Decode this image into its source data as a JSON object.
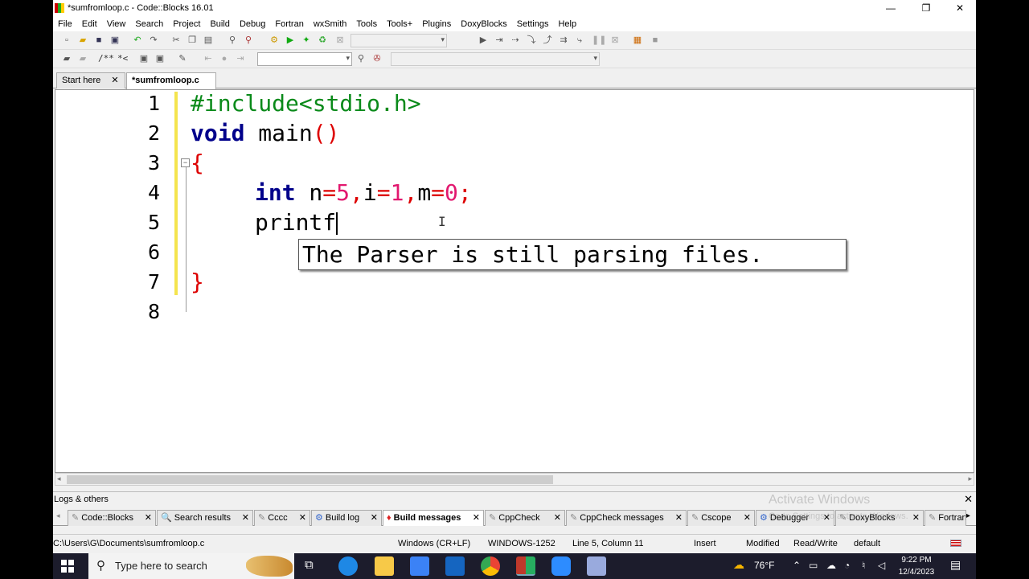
{
  "window": {
    "title": "*sumfromloop.c - Code::Blocks 16.01",
    "controls": {
      "minimize": "—",
      "maximize": "❐",
      "close": "✕"
    }
  },
  "menu": [
    "File",
    "Edit",
    "View",
    "Search",
    "Project",
    "Build",
    "Debug",
    "Fortran",
    "wxSmith",
    "Tools",
    "Tools+",
    "Plugins",
    "DoxyBlocks",
    "Settings",
    "Help"
  ],
  "toolbar2": {
    "comment_label": "/**",
    "stream_label": "*<"
  },
  "editor_tabs": [
    {
      "label": "Start here",
      "close": "✕",
      "active": false
    },
    {
      "label": "*sumfromloop.c",
      "close": "✕",
      "active": true
    }
  ],
  "editor": {
    "line_numbers": [
      "1",
      "2",
      "3",
      "4",
      "5",
      "6",
      "7",
      "8"
    ],
    "fold_marker": "−",
    "line1": {
      "pp": "#include<stdio.h>"
    },
    "line2": {
      "kw": "void",
      "rest": " main",
      "paren": "()"
    },
    "line3": {
      "brace": "{"
    },
    "line4": {
      "kw": "int",
      "a": " n",
      "eq1": "=",
      "n1": "5",
      "c1": ",",
      "b": "i",
      "eq2": "=",
      "n2": "1",
      "c2": ",",
      "c": "m",
      "eq3": "=",
      "n3": "0",
      "semi": ";"
    },
    "line5": {
      "text": "printf"
    },
    "line7": {
      "brace": "}"
    },
    "tooltip": "The Parser is still parsing files."
  },
  "logs": {
    "header": "Logs & others",
    "close": "✕",
    "tabs": [
      {
        "label": "Code::Blocks",
        "icon": "✎",
        "active": false
      },
      {
        "label": "Search results",
        "icon": "🔍",
        "active": false
      },
      {
        "label": "Cccc",
        "icon": "✎",
        "active": false
      },
      {
        "label": "Build log",
        "icon": "⚙",
        "active": false
      },
      {
        "label": "Build messages",
        "icon": "♦",
        "active": true
      },
      {
        "label": "CppCheck",
        "icon": "✎",
        "active": false
      },
      {
        "label": "CppCheck messages",
        "icon": "✎",
        "active": false
      },
      {
        "label": "Cscope",
        "icon": "✎",
        "active": false
      },
      {
        "label": "Debugger",
        "icon": "⚙",
        "active": false
      },
      {
        "label": "DoxyBlocks",
        "icon": "✎",
        "active": false
      },
      {
        "label": "Fortran",
        "icon": "✎",
        "active": false
      }
    ],
    "tab_close": "✕",
    "scroll_right": "▸"
  },
  "status": {
    "path": "C:\\Users\\G\\Documents\\sumfromloop.c",
    "line_endings": "Windows (CR+LF)",
    "encoding": "WINDOWS-1252",
    "position": "Line 5, Column 11",
    "insert_mode": "Insert",
    "modified": "Modified",
    "access": "Read/Write",
    "profile": "default"
  },
  "watermark": {
    "line1": "Activate Windows",
    "line2": "Go to Settings to activate Windows."
  },
  "taskbar": {
    "search_placeholder": "Type here to search",
    "temperature": "76°F",
    "time": "9:22 PM",
    "date": "12/4/2023",
    "colors": {
      "edge": "#1e88e5",
      "explorer": "#f7c948",
      "store": "#3b82f6",
      "mail": "#1565c0",
      "chrome": "#34a853",
      "codeblocks": "#c0392b",
      "zoom": "#2d8cff"
    }
  }
}
